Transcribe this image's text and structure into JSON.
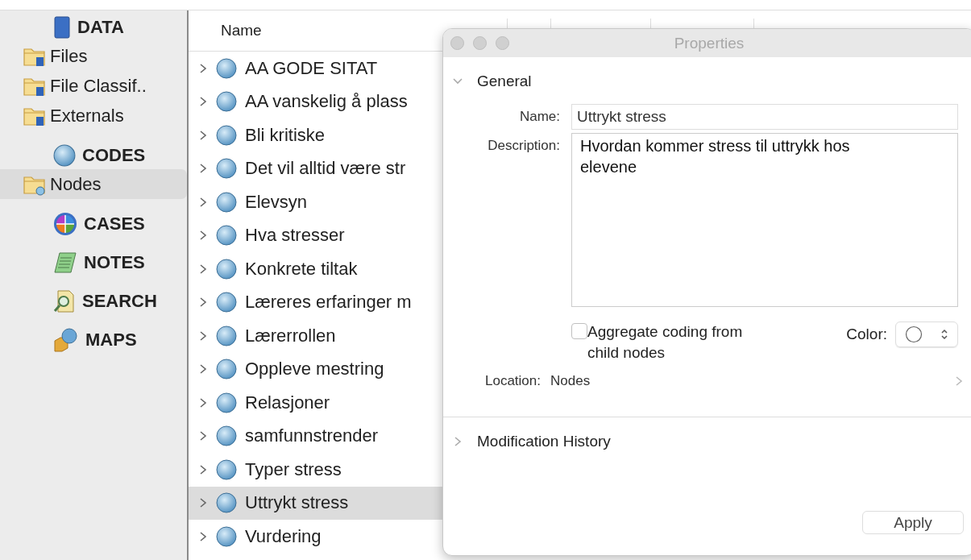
{
  "sidebar": {
    "sections": [
      {
        "title": "DATA",
        "items": [
          {
            "label": "Files",
            "selected": false
          },
          {
            "label": "File Classif..",
            "selected": false
          },
          {
            "label": "Externals",
            "selected": false
          }
        ]
      },
      {
        "title": "CODES",
        "items": [
          {
            "label": "Nodes",
            "selected": true
          }
        ]
      },
      {
        "title": "CASES"
      },
      {
        "title": "NOTES"
      },
      {
        "title": "SEARCH"
      },
      {
        "title": "MAPS"
      }
    ]
  },
  "table": {
    "columns": [
      "Name"
    ],
    "rows": [
      {
        "name": "AA GODE SITAT",
        "selected": false
      },
      {
        "name": "AA vanskelig å plass",
        "selected": false
      },
      {
        "name": "Bli kritiske",
        "selected": false
      },
      {
        "name": "Det vil alltid være str",
        "selected": false
      },
      {
        "name": "Elevsyn",
        "selected": false
      },
      {
        "name": "Hva stresser",
        "selected": false
      },
      {
        "name": "Konkrete tiltak",
        "selected": false
      },
      {
        "name": "Læreres erfaringer m",
        "selected": false
      },
      {
        "name": "Lærerrollen",
        "selected": false
      },
      {
        "name": "Oppleve mestring",
        "selected": false
      },
      {
        "name": "Relasjoner",
        "selected": false
      },
      {
        "name": "samfunnstrender",
        "selected": false
      },
      {
        "name": "Typer stress",
        "selected": false
      },
      {
        "name": "Uttrykt stress",
        "selected": true
      },
      {
        "name": "Vurdering",
        "selected": false
      }
    ]
  },
  "dialog": {
    "title": "Properties",
    "general": {
      "title": "General",
      "expanded": true,
      "name_label": "Name:",
      "name_value": "Uttrykt stress",
      "description_label": "Description:",
      "description_value": "Hvordan kommer stress til uttrykk hos elevene",
      "aggregate": {
        "label": "Aggregate coding from child nodes",
        "checked": false
      },
      "color_label": "Color:",
      "location_label": "Location:",
      "location_value": "Nodes"
    },
    "history": {
      "title": "Modification History",
      "expanded": false
    },
    "apply": "Apply"
  }
}
